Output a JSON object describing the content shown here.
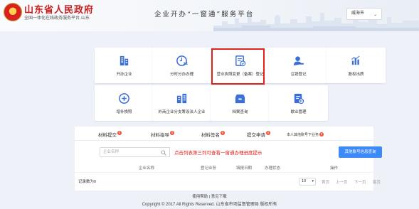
{
  "header": {
    "gov_title": "山东省人民政府",
    "gov_subtitle": "全国一体化在线政务服务平台·山东",
    "service_title": "企业开办“一窗通”服务平台",
    "city_select": "威海市"
  },
  "tiles": [
    {
      "label": "开办企业",
      "icon": "building-icon"
    },
    {
      "label": "分时分办办理",
      "icon": "clock-24-icon"
    },
    {
      "label": "营业执照变更（备案）登记",
      "icon": "document-edit-icon"
    },
    {
      "label": "注销登记",
      "icon": "user-minus-icon"
    },
    {
      "label": "股权出质",
      "icon": "bar-chart-icon"
    },
    {
      "label": "增补换照",
      "icon": "plus-circle-icon"
    },
    {
      "label": "外商企业分支筹设法人企业",
      "icon": "building-link-icon"
    },
    {
      "label": "档案查询",
      "icon": "archive-icon"
    },
    {
      "label": "歇业管理",
      "icon": "document-pause-icon"
    }
  ],
  "tabs": [
    {
      "label": "材料提交",
      "badge": "0"
    },
    {
      "label": "材料指导",
      "badge": "0"
    },
    {
      "label": "材料签名",
      "badge": "0"
    },
    {
      "label": "提交申请",
      "badge": "0"
    },
    {
      "label": "本人其他账号下业务",
      "badge": "0"
    }
  ],
  "search": {
    "placeholder": "企业名称"
  },
  "hint": "点击列表第三列可查看一窗通办理进度提示",
  "query_button": "其他账号信息查询",
  "table_headers": [
    "企业名称",
    "登记业务",
    "填报日期",
    "办理状态",
    "操作"
  ],
  "record_count": "记录数为0",
  "pagination": {
    "page_size": "10",
    "first": "首页",
    "prev": "上一页",
    "next": "下一页",
    "last": "尾页"
  },
  "footer": {
    "links": "使用帮助 | 意见下载",
    "copyright": "Copyright © 2017 All Rights Reserved. 山东省市场监督管理局 版权所有"
  },
  "colors": {
    "accent": "#3c8af7",
    "highlight_border": "#e1201c",
    "title_red": "#c81d1d",
    "badge": "#f0533c"
  }
}
